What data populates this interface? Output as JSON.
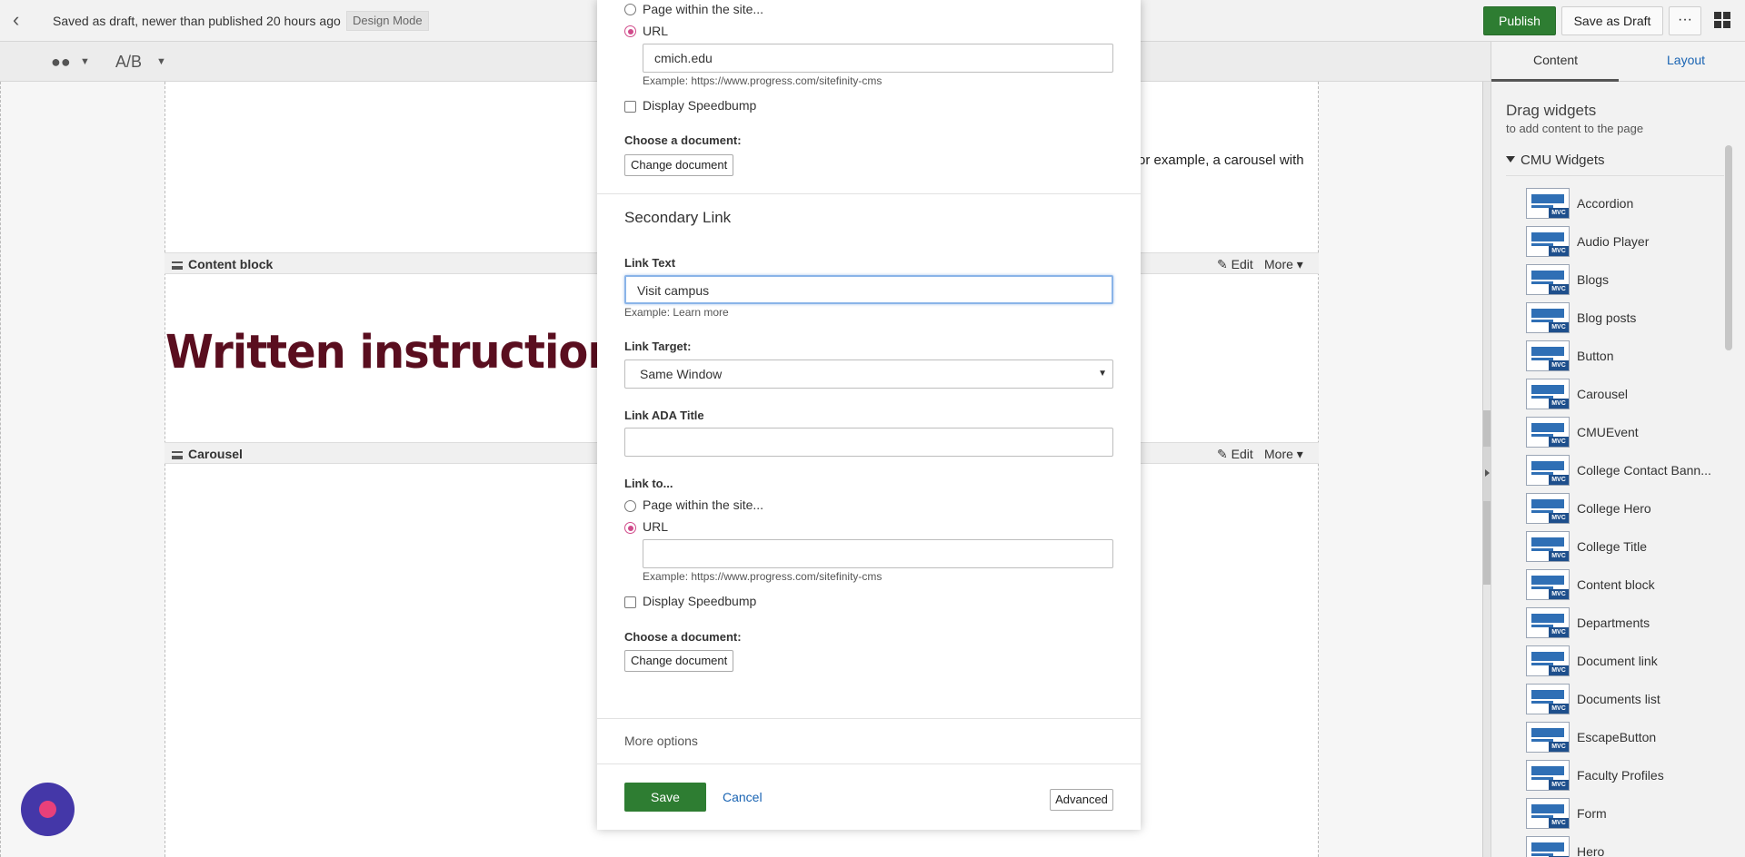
{
  "topbar": {
    "status": "Saved as draft, newer than published 20 hours ago",
    "mode": "Design Mode",
    "publish": "Publish",
    "save_draft": "Save as Draft",
    "more": "···"
  },
  "toolbar2": {
    "ab": "A/B"
  },
  "canvas": {
    "bg_text": "or example, a carousel with",
    "content_block": {
      "name": "Content block",
      "edit": "Edit",
      "more": "More"
    },
    "written": "Written instructions",
    "carousel": {
      "name": "Carousel",
      "edit": "Edit",
      "more": "More"
    }
  },
  "modal": {
    "top": {
      "page_within": "Page within the site...",
      "url": "URL",
      "url_value": "cmich.edu",
      "url_example": "Example: https://www.progress.com/sitefinity-cms",
      "speedbump": "Display Speedbump",
      "choose_doc": "Choose a document:",
      "change_doc": "Change document"
    },
    "secondary": {
      "heading": "Secondary Link",
      "link_text_label": "Link Text",
      "link_text_value": "Visit campus",
      "link_text_example": "Example: Learn more",
      "link_target_label": "Link Target:",
      "link_target_value": "Same Window",
      "ada_label": "Link ADA Title",
      "ada_value": "",
      "link_to": "Link to...",
      "page_within": "Page within the site...",
      "url": "URL",
      "url_value": "",
      "url_example": "Example: https://www.progress.com/sitefinity-cms",
      "speedbump": "Display Speedbump",
      "choose_doc": "Choose a document:",
      "change_doc": "Change document"
    },
    "more_options": "More options",
    "save": "Save",
    "cancel": "Cancel",
    "advanced": "Advanced"
  },
  "rpanel": {
    "tab_content": "Content",
    "tab_layout": "Layout",
    "drag_title": "Drag widgets",
    "drag_sub": "to add content to the page",
    "group": "CMU Widgets",
    "widgets": [
      "Accordion",
      "Audio Player",
      "Blogs",
      "Blog posts",
      "Button",
      "Carousel",
      "CMUEvent",
      "College Contact Bann...",
      "College Hero",
      "College Title",
      "Content block",
      "Departments",
      "Document link",
      "Documents list",
      "EscapeButton",
      "Faculty Profiles",
      "Form",
      "Hero"
    ]
  }
}
